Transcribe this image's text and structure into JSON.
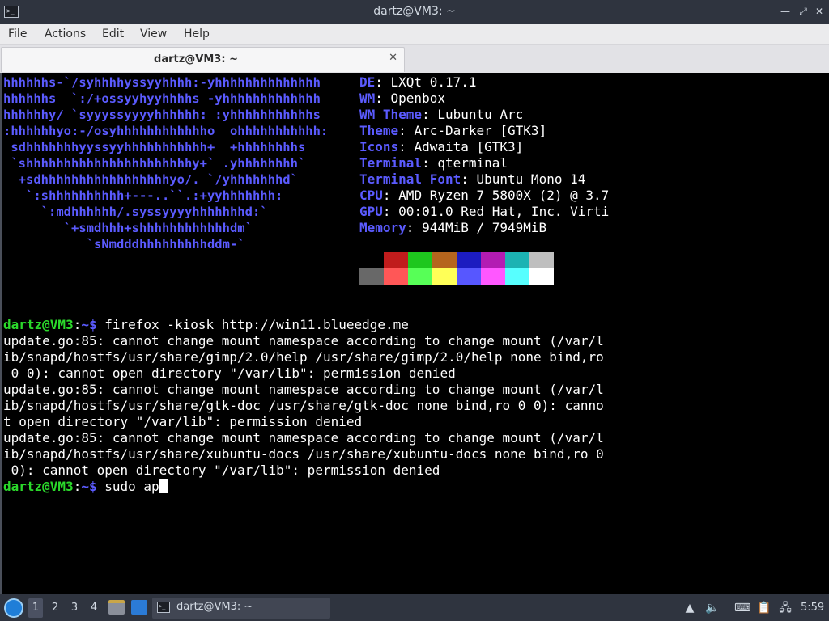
{
  "window": {
    "title": "dartz@VM3: ~"
  },
  "menu": [
    "File",
    "Actions",
    "Edit",
    "View",
    "Help"
  ],
  "tab": {
    "label": "dartz@VM3: ~"
  },
  "neofetch": {
    "logo": [
      "hhhhhhs-`/syhhhhyssyyhhhh:-yhhhhhhhhhhhhhh",
      "hhhhhhs  `:/+ossyyhyyhhhhs -yhhhhhhhhhhhhh",
      "hhhhhhy/ `syyyssyyyyhhhhhh: :yhhhhhhhhhhhs",
      ":hhhhhhyo:-/osyhhhhhhhhhhhho  ohhhhhhhhhhh:",
      " sdhhhhhhhyyssyyhhhhhhhhhhh+  +hhhhhhhhs",
      " `shhhhhhhhhhhhhhhhhhhhhhy+` .yhhhhhhhh`",
      "  +sdhhhhhhhhhhhhhhhhhyo/. `/yhhhhhhhd`",
      "   `:shhhhhhhhhh+---..``.:+yyhhhhhhh:",
      "     `:mdhhhhhh/.syssyyyyhhhhhhhd:`",
      "        `+smdhhh+shhhhhhhhhhhhdm`",
      "           `sNmdddhhhhhhhhhddm-`"
    ],
    "info": [
      {
        "key": "DE",
        "value": "LXQt 0.17.1"
      },
      {
        "key": "WM",
        "value": "Openbox"
      },
      {
        "key": "WM Theme",
        "value": "Lubuntu Arc"
      },
      {
        "key": "Theme",
        "value": "Arc-Darker [GTK3]"
      },
      {
        "key": "Icons",
        "value": "Adwaita [GTK3]"
      },
      {
        "key": "Terminal",
        "value": "qterminal"
      },
      {
        "key": "Terminal Font",
        "value": "Ubuntu Mono 14"
      },
      {
        "key": "CPU",
        "value": "AMD Ryzen 7 5800X (2) @ 3.7"
      },
      {
        "key": "GPU",
        "value": "00:01.0 Red Hat, Inc. Virti"
      },
      {
        "key": "Memory",
        "value": "944MiB / 7949MiB"
      }
    ],
    "colors_row1": [
      "#000000",
      "#c01c1c",
      "#1ec71e",
      "#b5651d",
      "#1c1cc0",
      "#b31cb3",
      "#1cb3b3",
      "#bfbfbf"
    ],
    "colors_row2": [
      "#686868",
      "#ff5757",
      "#57ff57",
      "#ffff57",
      "#5757ff",
      "#ff57ff",
      "#57ffff",
      "#ffffff"
    ]
  },
  "session": {
    "prompt_user": "dartz@VM3",
    "prompt_path": "~$",
    "command1": " firefox -kiosk http://win11.blueedge.me",
    "output": [
      "update.go:85: cannot change mount namespace according to change mount (/var/l",
      "ib/snapd/hostfs/usr/share/gimp/2.0/help /usr/share/gimp/2.0/help none bind,ro",
      " 0 0): cannot open directory \"/var/lib\": permission denied",
      "update.go:85: cannot change mount namespace according to change mount (/var/l",
      "ib/snapd/hostfs/usr/share/gtk-doc /usr/share/gtk-doc none bind,ro 0 0): canno",
      "t open directory \"/var/lib\": permission denied",
      "update.go:85: cannot change mount namespace according to change mount (/var/l",
      "ib/snapd/hostfs/usr/share/xubuntu-docs /usr/share/xubuntu-docs none bind,ro 0",
      " 0): cannot open directory \"/var/lib\": permission denied"
    ],
    "command2": " sudo ap"
  },
  "taskbar": {
    "workspaces": [
      "1",
      "2",
      "3",
      "4"
    ],
    "task_label": "dartz@VM3: ~",
    "clock": "5:59"
  }
}
